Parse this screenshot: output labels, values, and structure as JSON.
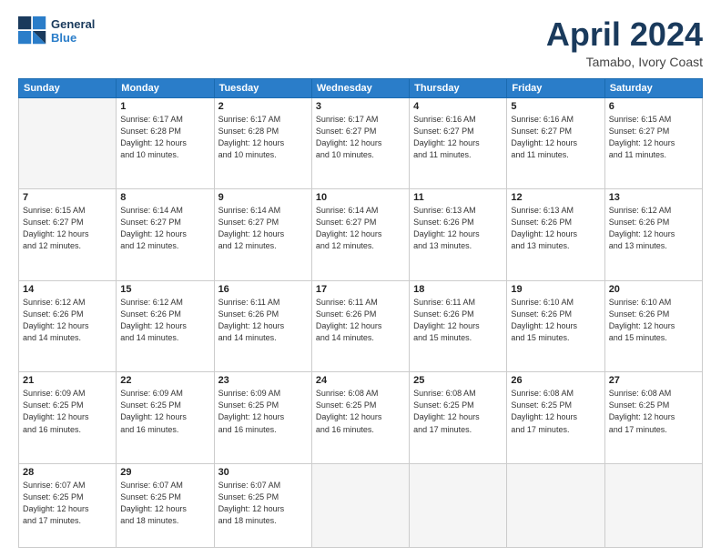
{
  "header": {
    "logo_line1": "General",
    "logo_line2": "Blue",
    "month": "April 2024",
    "location": "Tamabo, Ivory Coast"
  },
  "weekdays": [
    "Sunday",
    "Monday",
    "Tuesday",
    "Wednesday",
    "Thursday",
    "Friday",
    "Saturday"
  ],
  "weeks": [
    [
      {
        "day": "",
        "info": ""
      },
      {
        "day": "1",
        "info": "Sunrise: 6:17 AM\nSunset: 6:28 PM\nDaylight: 12 hours\nand 10 minutes."
      },
      {
        "day": "2",
        "info": "Sunrise: 6:17 AM\nSunset: 6:28 PM\nDaylight: 12 hours\nand 10 minutes."
      },
      {
        "day": "3",
        "info": "Sunrise: 6:17 AM\nSunset: 6:27 PM\nDaylight: 12 hours\nand 10 minutes."
      },
      {
        "day": "4",
        "info": "Sunrise: 6:16 AM\nSunset: 6:27 PM\nDaylight: 12 hours\nand 11 minutes."
      },
      {
        "day": "5",
        "info": "Sunrise: 6:16 AM\nSunset: 6:27 PM\nDaylight: 12 hours\nand 11 minutes."
      },
      {
        "day": "6",
        "info": "Sunrise: 6:15 AM\nSunset: 6:27 PM\nDaylight: 12 hours\nand 11 minutes."
      }
    ],
    [
      {
        "day": "7",
        "info": "Sunrise: 6:15 AM\nSunset: 6:27 PM\nDaylight: 12 hours\nand 12 minutes."
      },
      {
        "day": "8",
        "info": "Sunrise: 6:14 AM\nSunset: 6:27 PM\nDaylight: 12 hours\nand 12 minutes."
      },
      {
        "day": "9",
        "info": "Sunrise: 6:14 AM\nSunset: 6:27 PM\nDaylight: 12 hours\nand 12 minutes."
      },
      {
        "day": "10",
        "info": "Sunrise: 6:14 AM\nSunset: 6:27 PM\nDaylight: 12 hours\nand 12 minutes."
      },
      {
        "day": "11",
        "info": "Sunrise: 6:13 AM\nSunset: 6:26 PM\nDaylight: 12 hours\nand 13 minutes."
      },
      {
        "day": "12",
        "info": "Sunrise: 6:13 AM\nSunset: 6:26 PM\nDaylight: 12 hours\nand 13 minutes."
      },
      {
        "day": "13",
        "info": "Sunrise: 6:12 AM\nSunset: 6:26 PM\nDaylight: 12 hours\nand 13 minutes."
      }
    ],
    [
      {
        "day": "14",
        "info": "Sunrise: 6:12 AM\nSunset: 6:26 PM\nDaylight: 12 hours\nand 14 minutes."
      },
      {
        "day": "15",
        "info": "Sunrise: 6:12 AM\nSunset: 6:26 PM\nDaylight: 12 hours\nand 14 minutes."
      },
      {
        "day": "16",
        "info": "Sunrise: 6:11 AM\nSunset: 6:26 PM\nDaylight: 12 hours\nand 14 minutes."
      },
      {
        "day": "17",
        "info": "Sunrise: 6:11 AM\nSunset: 6:26 PM\nDaylight: 12 hours\nand 14 minutes."
      },
      {
        "day": "18",
        "info": "Sunrise: 6:11 AM\nSunset: 6:26 PM\nDaylight: 12 hours\nand 15 minutes."
      },
      {
        "day": "19",
        "info": "Sunrise: 6:10 AM\nSunset: 6:26 PM\nDaylight: 12 hours\nand 15 minutes."
      },
      {
        "day": "20",
        "info": "Sunrise: 6:10 AM\nSunset: 6:26 PM\nDaylight: 12 hours\nand 15 minutes."
      }
    ],
    [
      {
        "day": "21",
        "info": "Sunrise: 6:09 AM\nSunset: 6:25 PM\nDaylight: 12 hours\nand 16 minutes."
      },
      {
        "day": "22",
        "info": "Sunrise: 6:09 AM\nSunset: 6:25 PM\nDaylight: 12 hours\nand 16 minutes."
      },
      {
        "day": "23",
        "info": "Sunrise: 6:09 AM\nSunset: 6:25 PM\nDaylight: 12 hours\nand 16 minutes."
      },
      {
        "day": "24",
        "info": "Sunrise: 6:08 AM\nSunset: 6:25 PM\nDaylight: 12 hours\nand 16 minutes."
      },
      {
        "day": "25",
        "info": "Sunrise: 6:08 AM\nSunset: 6:25 PM\nDaylight: 12 hours\nand 17 minutes."
      },
      {
        "day": "26",
        "info": "Sunrise: 6:08 AM\nSunset: 6:25 PM\nDaylight: 12 hours\nand 17 minutes."
      },
      {
        "day": "27",
        "info": "Sunrise: 6:08 AM\nSunset: 6:25 PM\nDaylight: 12 hours\nand 17 minutes."
      }
    ],
    [
      {
        "day": "28",
        "info": "Sunrise: 6:07 AM\nSunset: 6:25 PM\nDaylight: 12 hours\nand 17 minutes."
      },
      {
        "day": "29",
        "info": "Sunrise: 6:07 AM\nSunset: 6:25 PM\nDaylight: 12 hours\nand 18 minutes."
      },
      {
        "day": "30",
        "info": "Sunrise: 6:07 AM\nSunset: 6:25 PM\nDaylight: 12 hours\nand 18 minutes."
      },
      {
        "day": "",
        "info": ""
      },
      {
        "day": "",
        "info": ""
      },
      {
        "day": "",
        "info": ""
      },
      {
        "day": "",
        "info": ""
      }
    ]
  ]
}
